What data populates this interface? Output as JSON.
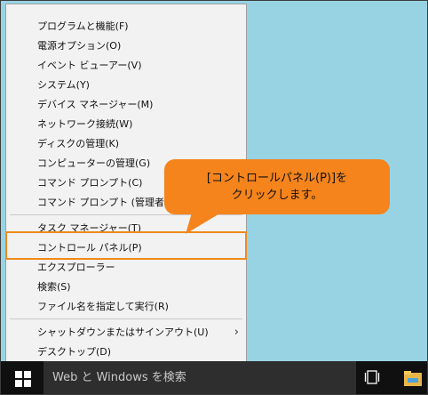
{
  "menu": {
    "items": [
      {
        "label": "プログラムと機能(F)"
      },
      {
        "label": "電源オプション(O)"
      },
      {
        "label": "イベント ビューアー(V)"
      },
      {
        "label": "システム(Y)"
      },
      {
        "label": "デバイス マネージャー(M)"
      },
      {
        "label": "ネットワーク接続(W)"
      },
      {
        "label": "ディスクの管理(K)"
      },
      {
        "label": "コンピューターの管理(G)"
      },
      {
        "label": "コマンド プロンプト(C)"
      },
      {
        "label": "コマンド プロンプト (管理者)(A)"
      },
      {
        "label": "タスク マネージャー(T)"
      },
      {
        "label": "コントロール パネル(P)"
      },
      {
        "label": "エクスプローラー"
      },
      {
        "label": "検索(S)"
      },
      {
        "label": "ファイル名を指定して実行(R)"
      },
      {
        "label": "シャットダウンまたはサインアウト(U)"
      },
      {
        "label": "デスクトップ(D)"
      }
    ],
    "submenu_arrow": "›"
  },
  "callout": {
    "line1": "[コントロールパネル(P)]を",
    "line2": "クリックします。"
  },
  "taskbar": {
    "search_placeholder": "Web と Windows を検索"
  },
  "colors": {
    "accent_orange": "#f5841c",
    "highlight_border": "#f08a1c",
    "desktop": "#97d3e3",
    "taskbar": "#101010"
  },
  "icons": {
    "start": "windows-logo-icon",
    "taskview": "task-view-icon",
    "explorer": "file-explorer-icon"
  }
}
